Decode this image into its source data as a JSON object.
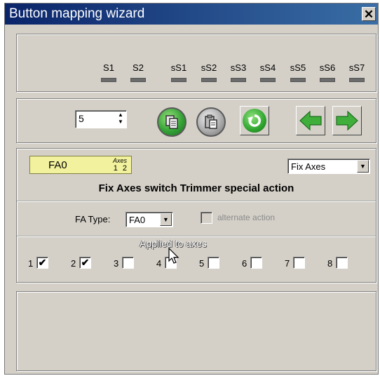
{
  "window": {
    "title": "Button mapping wizard",
    "close_label": "✕"
  },
  "status": {
    "items": [
      {
        "label": "S1"
      },
      {
        "label": "S2"
      },
      {
        "label": "sS1"
      },
      {
        "label": "sS2"
      },
      {
        "label": "sS3"
      },
      {
        "label": "sS4"
      },
      {
        "label": "sS5"
      },
      {
        "label": "sS6"
      },
      {
        "label": "sS7"
      }
    ]
  },
  "toolbar": {
    "spin_value": "5",
    "spin_up": "▲",
    "spin_down": "▼",
    "icons": [
      "copy-icon",
      "paste-icon",
      "reset-icon",
      "back-arrow-icon",
      "forward-arrow-icon"
    ]
  },
  "action": {
    "badge_label": "FA0",
    "badge_axes_caption": "Axes",
    "badge_axes_numbers": "1 2",
    "mode_select": "Fix Axes",
    "heading": "Fix Axes switch Trimmer special action",
    "fa_type_label": "FA Type:",
    "fa_type_value": "FA0",
    "alternate_label": "alternate action",
    "applied_label": "Applied to axes",
    "axes": [
      {
        "num": "1",
        "checked": true,
        "mark": "✔"
      },
      {
        "num": "2",
        "checked": true,
        "mark": "✔"
      },
      {
        "num": "3",
        "checked": false,
        "mark": ""
      },
      {
        "num": "4",
        "checked": false,
        "mark": ""
      },
      {
        "num": "5",
        "checked": false,
        "mark": ""
      },
      {
        "num": "6",
        "checked": false,
        "mark": ""
      },
      {
        "num": "7",
        "checked": false,
        "mark": ""
      },
      {
        "num": "8",
        "checked": false,
        "mark": ""
      }
    ]
  },
  "colors": {
    "title_bar": "#0a246a",
    "window_bg": "#d4d0c8",
    "badge_bg": "#f2f29e",
    "green": "#34a336"
  }
}
